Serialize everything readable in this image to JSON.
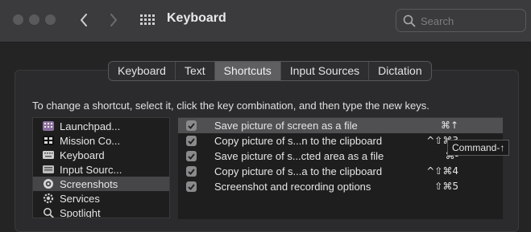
{
  "window": {
    "title": "Keyboard",
    "search": {
      "placeholder": "Search",
      "value": ""
    }
  },
  "tabs": [
    {
      "label": "Keyboard",
      "active": false
    },
    {
      "label": "Text",
      "active": false
    },
    {
      "label": "Shortcuts",
      "active": true
    },
    {
      "label": "Input Sources",
      "active": false
    },
    {
      "label": "Dictation",
      "active": false
    }
  ],
  "instructions": "To change a shortcut, select it, click the key combination, and then type the new keys.",
  "categories": [
    {
      "label": "Launchpad...",
      "icon": "launchpad-icon",
      "selected": false
    },
    {
      "label": "Mission Co...",
      "icon": "mission-control-icon",
      "selected": false
    },
    {
      "label": "Keyboard",
      "icon": "keyboard-icon",
      "selected": false
    },
    {
      "label": "Input Sourc...",
      "icon": "input-sources-icon",
      "selected": false
    },
    {
      "label": "Screenshots",
      "icon": "screenshot-icon",
      "selected": true
    },
    {
      "label": "Services",
      "icon": "services-icon",
      "selected": false
    },
    {
      "label": "Spotlight",
      "icon": "spotlight-icon",
      "selected": false
    }
  ],
  "shortcuts": [
    {
      "label": "Save picture of screen as a file",
      "keys": "⌘↑",
      "checked": true,
      "selected": true
    },
    {
      "label": "Copy picture of s...n to the clipboard",
      "keys": "^⇧⌘3",
      "checked": true,
      "selected": false
    },
    {
      "label": "Save picture of s...cted area as a file",
      "keys": "⌘-",
      "checked": true,
      "selected": false
    },
    {
      "label": "Copy picture of s...a to the clipboard",
      "keys": "^⇧⌘4",
      "checked": true,
      "selected": false
    },
    {
      "label": "Screenshot and recording options",
      "keys": "⇧⌘5",
      "checked": true,
      "selected": false
    }
  ],
  "tooltip": "Command-↑"
}
